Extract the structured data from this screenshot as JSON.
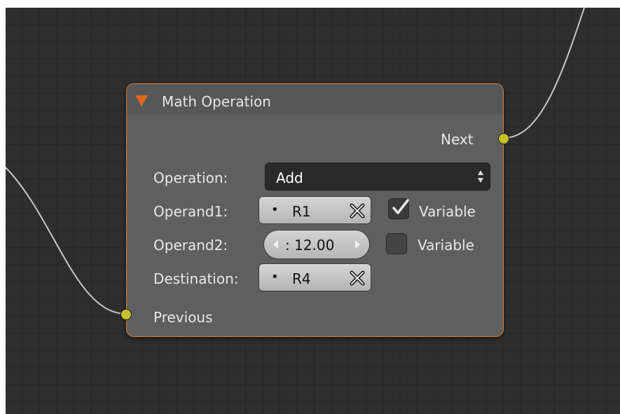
{
  "node": {
    "title": "Math Operation",
    "output_socket": "Next",
    "input_socket": "Previous",
    "accent_color": "#e0832a",
    "socket_color": "#c6c22e",
    "operation": {
      "label": "Operation:",
      "value": "Add"
    },
    "operand1": {
      "label": "Operand1:",
      "value": "R1",
      "variable_label": "Variable",
      "variable_checked": true
    },
    "operand2": {
      "label": "Operand2:",
      "value": ": 12.00",
      "variable_label": "Variable",
      "variable_checked": false
    },
    "destination": {
      "label": "Destination:",
      "value": "R4"
    }
  },
  "icons": {
    "collapse": "triangle-down-icon",
    "operation_select": "updown-arrows-icon",
    "clear": "x-icon",
    "check": "checkmark-icon",
    "decrement": "arrow-left-icon",
    "increment": "arrow-right-icon"
  }
}
